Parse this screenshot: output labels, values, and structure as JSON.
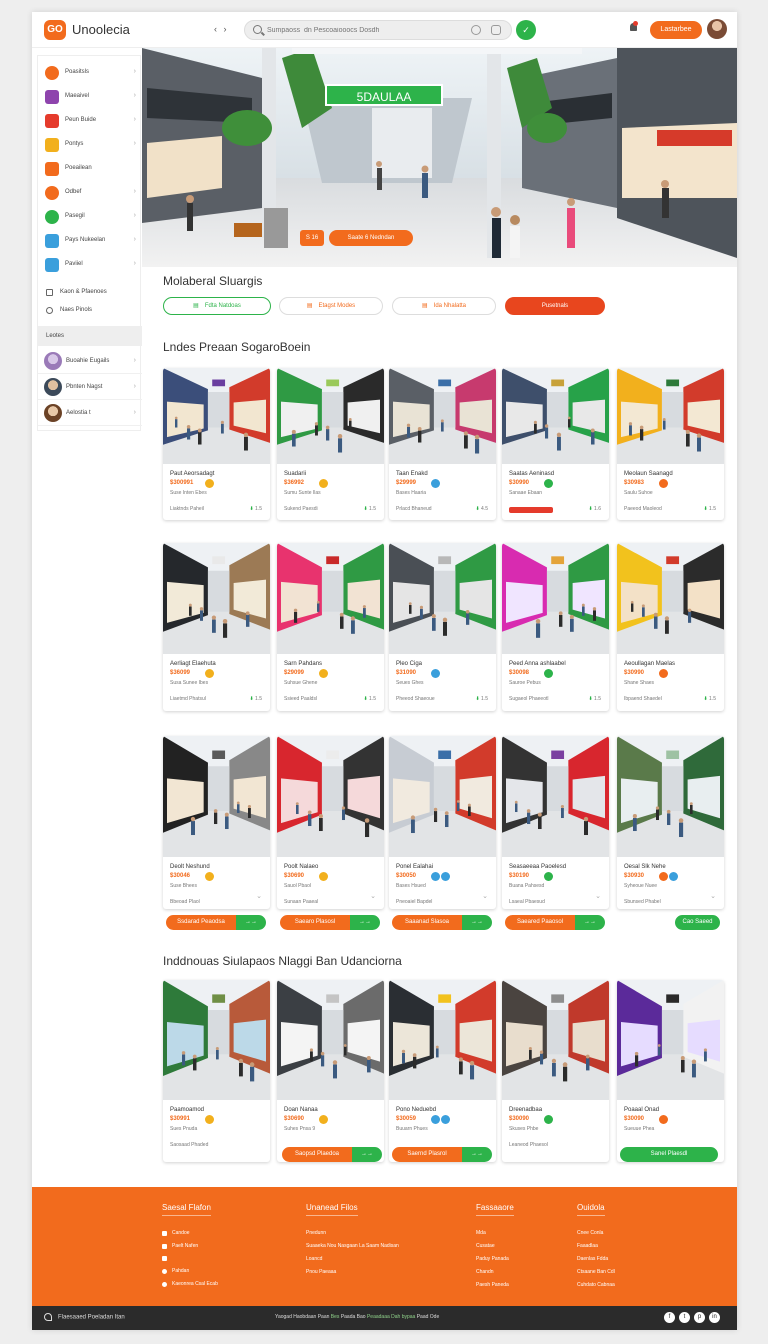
{
  "header": {
    "logo_text": "GO",
    "app_title": "Unoolecia",
    "nav_arrows": "‹ ›",
    "search_placeholder": "Sumpaoss  dn Pescoaiooocs Dosdh",
    "login_label": "Lastarbee",
    "green_button_icon": "leaf-icon"
  },
  "sidebar": {
    "items": [
      {
        "label": "Poasitsls",
        "color": "#f26b1d",
        "icon": "store-icon"
      },
      {
        "label": "Maeaivel",
        "color": "#8e44ad",
        "icon": "tag-icon"
      },
      {
        "label": "Peun Buide",
        "color": "#e53b2c",
        "icon": "guide-icon"
      },
      {
        "label": "Pontys",
        "color": "#f2b01d",
        "icon": "party-icon"
      },
      {
        "label": "Poeailean",
        "color": "#f26b1d",
        "icon": "calendar-icon"
      },
      {
        "label": "Odbef",
        "color": "#f26b1d",
        "icon": "offer-icon"
      },
      {
        "label": "Pasegil",
        "color": "#2db34a",
        "icon": "pin-icon"
      },
      {
        "label": "Pays Nukeelan",
        "color": "#3a9fdc",
        "icon": "chat-icon"
      },
      {
        "label": "Paviiel",
        "color": "#3a9fdc",
        "icon": "car-icon"
      }
    ],
    "small_items": [
      "Kaon & Pfaenoes",
      "Naes Pinols"
    ],
    "section_label": "Leotes",
    "users": [
      {
        "name": "Buoahie  Eugails"
      },
      {
        "name": "Pbnten Nagst"
      },
      {
        "name": "Aelostia  t"
      }
    ]
  },
  "hero": {
    "banner": "5DAULAA",
    "cta_small": "S  16",
    "cta_main": "Saate 6 Nedndan"
  },
  "section1": {
    "title": "Molaberal Sluargis",
    "filters": [
      {
        "label": "Fdta Natdoas",
        "icon": "▤"
      },
      {
        "label": "Etagst Modes",
        "icon": "▤"
      },
      {
        "label": "Ida  Nhalatta",
        "icon": "▤"
      },
      {
        "label": "Pusetnals",
        "icon": ""
      }
    ]
  },
  "section2": {
    "title": "Lndes Preaan SogaroBoein"
  },
  "row1": [
    {
      "name": "Paut Aeorsadagt",
      "price": "$300991",
      "sub": "Suse Inten Ebes",
      "foot": "Liaktnds  Paheil",
      "rating": "1.5"
    },
    {
      "name": "Suadarii",
      "price": "$36992",
      "sub": "Sumu Sunte Ilas",
      "foot": "Sukend  Paesdi",
      "rating": "1.5"
    },
    {
      "name": "Taan Enakd",
      "price": "$29999",
      "sub": "Bases  Haaria",
      "foot": "Prlacd Bhaneud",
      "rating": "4.5"
    },
    {
      "name": "Saatas Aeninasd",
      "price": "$30990",
      "sub": "Sanaae  Ebaan",
      "foot": "",
      "rating": "1.6"
    },
    {
      "name": "Meolaun Saanagd",
      "price": "$30983",
      "sub": "Saulu Suhoe",
      "foot": "Paeeod  Maoleod",
      "rating": "1.5"
    }
  ],
  "row2": [
    {
      "name": "Aerliagt Elaehuta",
      "price": "$36099",
      "sub": "Susa Sunee Ibes",
      "foot": "Liaetmd  Phatsul",
      "rating": "1.5"
    },
    {
      "name": "Sarn Pahdans",
      "price": "$29099",
      "sub": "Suhsue Ghene",
      "foot": "Ssieed  Paaldsl",
      "rating": "1.5"
    },
    {
      "name": "Pleo Ciga",
      "price": "$31090",
      "sub": "Seues  Ghes",
      "foot": "Pheeod  Shaeoue",
      "rating": "1.5"
    },
    {
      "name": "Peed Anna ashlaabel",
      "price": "$30098",
      "sub": "Sauroe  Pebus",
      "foot": "Sugaeol  Phaeeotl",
      "rating": "1.5"
    },
    {
      "name": "Aeoullagan Maelas",
      "price": "$30990",
      "sub": "Shane  Shaes",
      "foot": "Ibpaend  Shaedel",
      "rating": "1.5"
    }
  ],
  "row3": [
    {
      "name": "Deolt Neshund",
      "price": "$30046",
      "sub": "Suse  Bhees",
      "foot": "Bbeoad  Plaol",
      "rating": ""
    },
    {
      "name": "Poolt Nalaeo",
      "price": "$30690",
      "sub": "Sauol  Pbaol",
      "foot": "Sunaan  Paaeal",
      "rating": ""
    },
    {
      "name": "Ponel Ealahai",
      "price": "$30050",
      "sub": "Bases  Hsued",
      "foot": "Pneoaiel  Bapdel",
      "rating": ""
    },
    {
      "name": "Seasaeeaa Paoelesd",
      "price": "$30190",
      "sub": "Buana  Pahsesd",
      "foot": "Lsaeal  Pbaesud",
      "rating": ""
    },
    {
      "name": "Oesal Slk Nehe",
      "price": "$30930",
      "sub": "Syheoue Nuee",
      "foot": "Sbunsed  Phabel",
      "rating": ""
    }
  ],
  "row3_buttons": [
    {
      "label": "Ssdarad Peaodsa",
      "icon": "→→"
    },
    {
      "label": "Saearo Plasosl",
      "icon": "→→"
    },
    {
      "label": "Saaanad Slasoa",
      "icon": "→→"
    },
    {
      "label": "Saeared Paaosol",
      "icon": "→→"
    },
    {
      "label": "Cao Saeed",
      "icon": ""
    }
  ],
  "section3": {
    "title": "Inddnouas Siulapaos Nlaggi Ban Udanciorna"
  },
  "row4": [
    {
      "name": "Paamoamod",
      "price": "$30991",
      "sub": "Sues  Pnuda",
      "foot": "Saosaad  Phaded"
    },
    {
      "name": "Doan Nanaa",
      "price": "$30690",
      "sub": "Suhes  Pnsa 9",
      "foot": ""
    },
    {
      "name": "Pono  Neduebd",
      "price": "$30059",
      "sub": "Buuarn  Phues",
      "foot": ""
    },
    {
      "name": "Dreenadbaa",
      "price": "$30090",
      "sub": "Skuses  Phbe",
      "foot": "Leaneod  Phaesol"
    },
    {
      "name": "Poaaal Onad",
      "price": "$30090",
      "sub": "Sueuue  Phea",
      "foot": ""
    }
  ],
  "row4_buttons": [
    {
      "label": "Saopsd Plaedoa",
      "icon": "→→"
    },
    {
      "label": "Saernd Plasrol",
      "icon": "→→"
    },
    {
      "label": "Sanel Plaesdl",
      "icon": "→→"
    }
  ],
  "footer": {
    "cols": [
      {
        "title": "Saesal Flafon",
        "links": [
          "Candoe",
          "Paelt Nafen",
          "",
          "Pahdan",
          "Kaeonrea Csal Ecab"
        ]
      },
      {
        "title": "Unanead Filos",
        "links": [
          "Pnedunn",
          "Suaaeka  Nou Nasgaan La Saam Nadisan",
          "Loancd",
          "Pnou Paeaaa"
        ]
      },
      {
        "title": "Fassaaore",
        "links": [
          "Mda",
          "Cusatae",
          "Paduy Panada",
          "Chandn",
          "Paesh Paneda"
        ]
      },
      {
        "title": "Ouidola",
        "links": [
          "Cnee Conla",
          "Faaadlaa",
          "Daenlas Fdda",
          "Ctsaane Ban Cdl",
          "Cuhdato Cabnaa"
        ]
      }
    ],
    "bottom_left": "Flaesaaed  Poeladan Itan",
    "bottom_mid_1": "Yaogad  Haobdaan Paan",
    "bottom_mid_2": "Bes",
    "bottom_mid_3": "Paada  Bao",
    "bottom_mid_4": "Peaadaaa  Dah bypaa",
    "bottom_mid_5": "Paad  Ode",
    "social": [
      "f",
      "t",
      "p",
      "in"
    ]
  }
}
